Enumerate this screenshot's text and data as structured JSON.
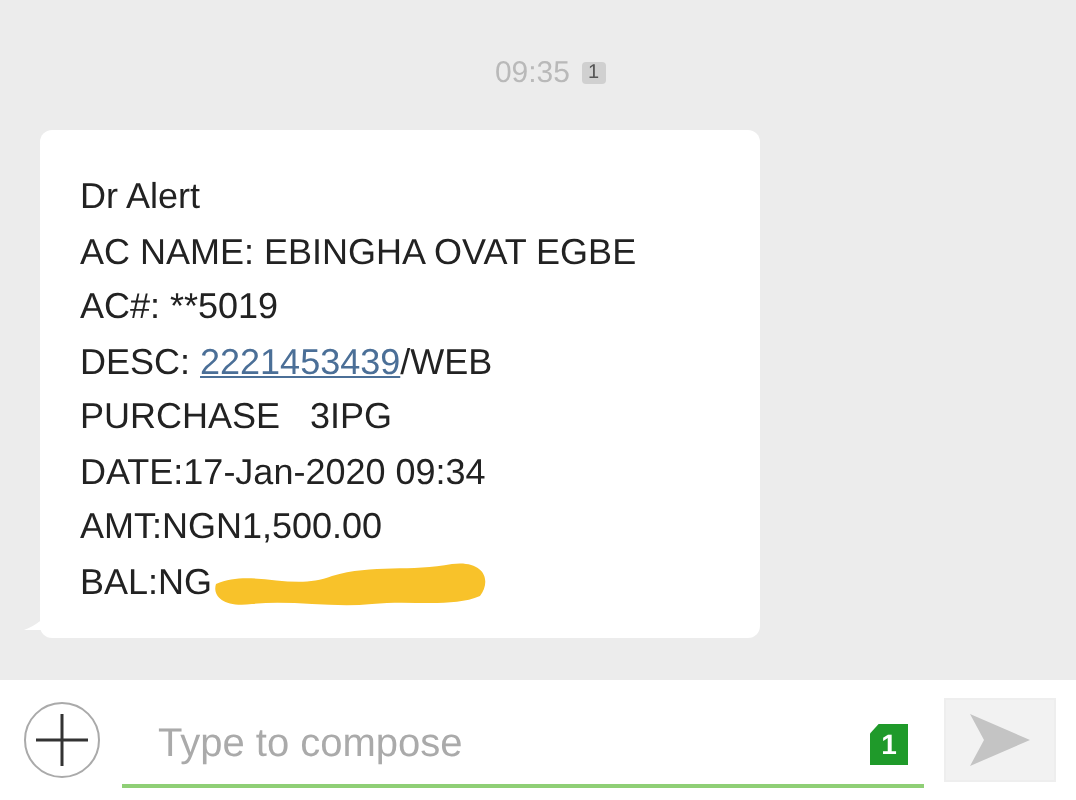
{
  "timestamp": {
    "time": "09:35",
    "sim": "1"
  },
  "message": {
    "lines": [
      {
        "kind": "text",
        "text": "Dr Alert"
      },
      {
        "kind": "text",
        "text": "AC NAME: EBINGHA OVAT EGBE"
      },
      {
        "kind": "text",
        "text": "AC#: **5019"
      },
      {
        "kind": "link",
        "before": "DESC: ",
        "link": "2221453439",
        "after": "/WEB"
      },
      {
        "kind": "text",
        "text": "PURCHASE   3IPG"
      },
      {
        "kind": "text",
        "text": "DATE:17-Jan-2020 09:34"
      },
      {
        "kind": "text",
        "text": "AMT:NGN1,500.00"
      },
      {
        "kind": "redacted",
        "text": "BAL:NG"
      }
    ]
  },
  "composer": {
    "placeholder": "Type to compose",
    "sim_badge": "1"
  }
}
